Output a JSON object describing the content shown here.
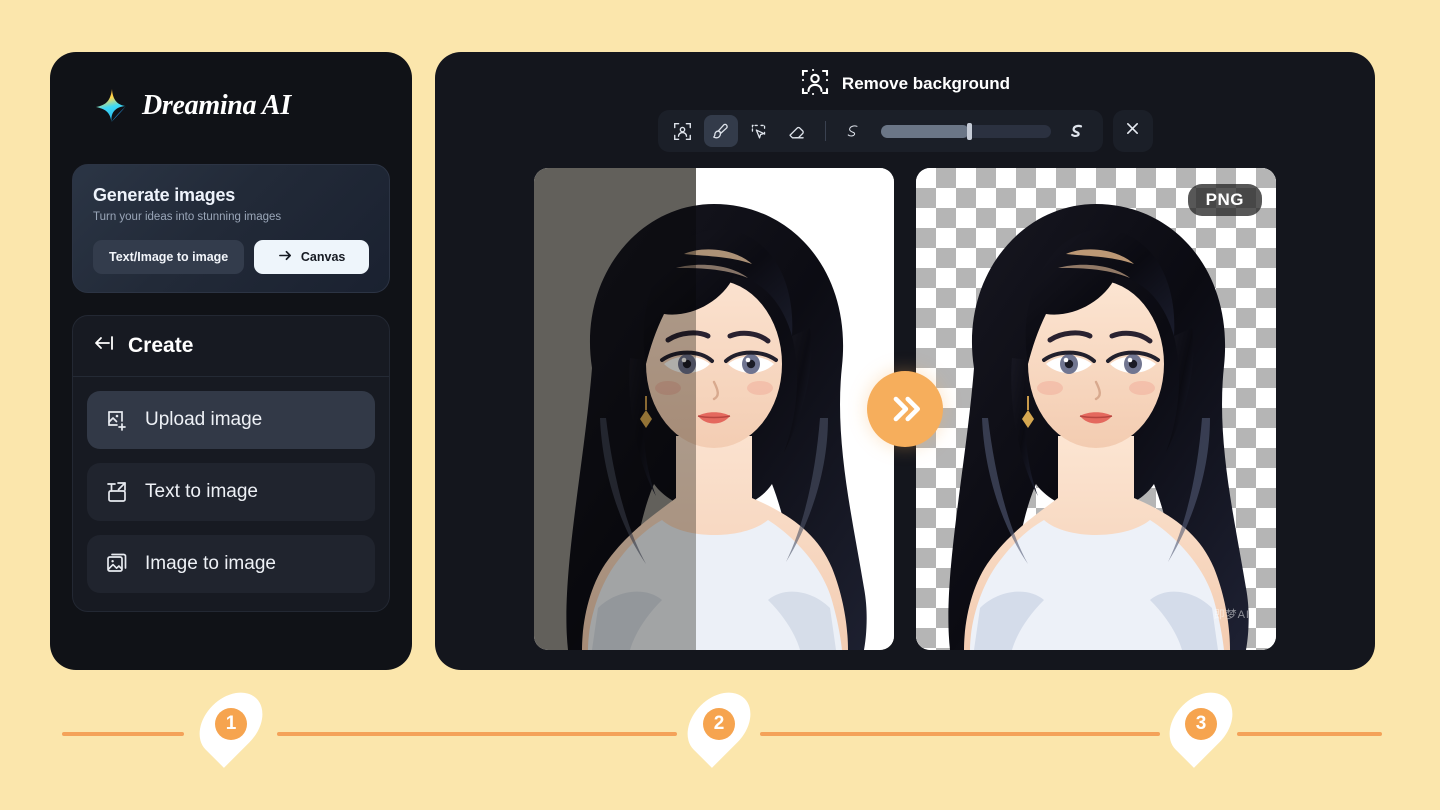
{
  "theme": {
    "page_bg": "#fbe6ac",
    "panel_bg": "#14161d",
    "sidebar_bg": "#101217",
    "accent_orange": "#f4a259",
    "accent_light": "#eef5fb"
  },
  "sidebar": {
    "brand": {
      "name": "Dreamina AI",
      "logo_icon": "sparkle-star-icon"
    },
    "generate_card": {
      "title": "Generate images",
      "subtitle": "Turn your ideas into stunning images",
      "primary_button": "Text/Image to image",
      "secondary_button": "Canvas",
      "secondary_button_icon": "arrow-right-icon"
    },
    "create_panel": {
      "back_icon": "collapse-left-icon",
      "title": "Create",
      "items": [
        {
          "label": "Upload image",
          "icon": "image-plus-icon",
          "active": true
        },
        {
          "label": "Text to image",
          "icon": "text-to-image-icon",
          "active": false
        },
        {
          "label": "Image to image",
          "icon": "image-stack-icon",
          "active": false
        }
      ]
    }
  },
  "editor": {
    "header": {
      "title": "Remove background",
      "icon": "person-in-selection-icon"
    },
    "toolbar": {
      "tools": [
        {
          "name": "auto-subject-select",
          "icon": "person-frame-icon",
          "active": false
        },
        {
          "name": "brush",
          "icon": "brush-icon",
          "active": true
        },
        {
          "name": "magic-select",
          "icon": "cursor-select-icon",
          "active": false
        },
        {
          "name": "eraser",
          "icon": "eraser-icon",
          "active": false
        }
      ],
      "slider": {
        "label": "Brush size",
        "min_icon": "thin-stroke-icon",
        "max_icon": "thick-stroke-icon",
        "value_percent": 52
      },
      "close_icon": "close-icon"
    },
    "before_image": {
      "name": "before-after-preview",
      "alt": "Anime portrait of woman with long black wavy hair, split grey / white background"
    },
    "after_image": {
      "name": "transparent-result-preview",
      "alt": "Same portrait on transparent checkerboard background",
      "badge": "PNG",
      "watermark": "即梦AI"
    },
    "transition_icon": "double-chevron-right-icon"
  },
  "steps": [
    {
      "number": "1"
    },
    {
      "number": "2"
    },
    {
      "number": "3"
    }
  ]
}
